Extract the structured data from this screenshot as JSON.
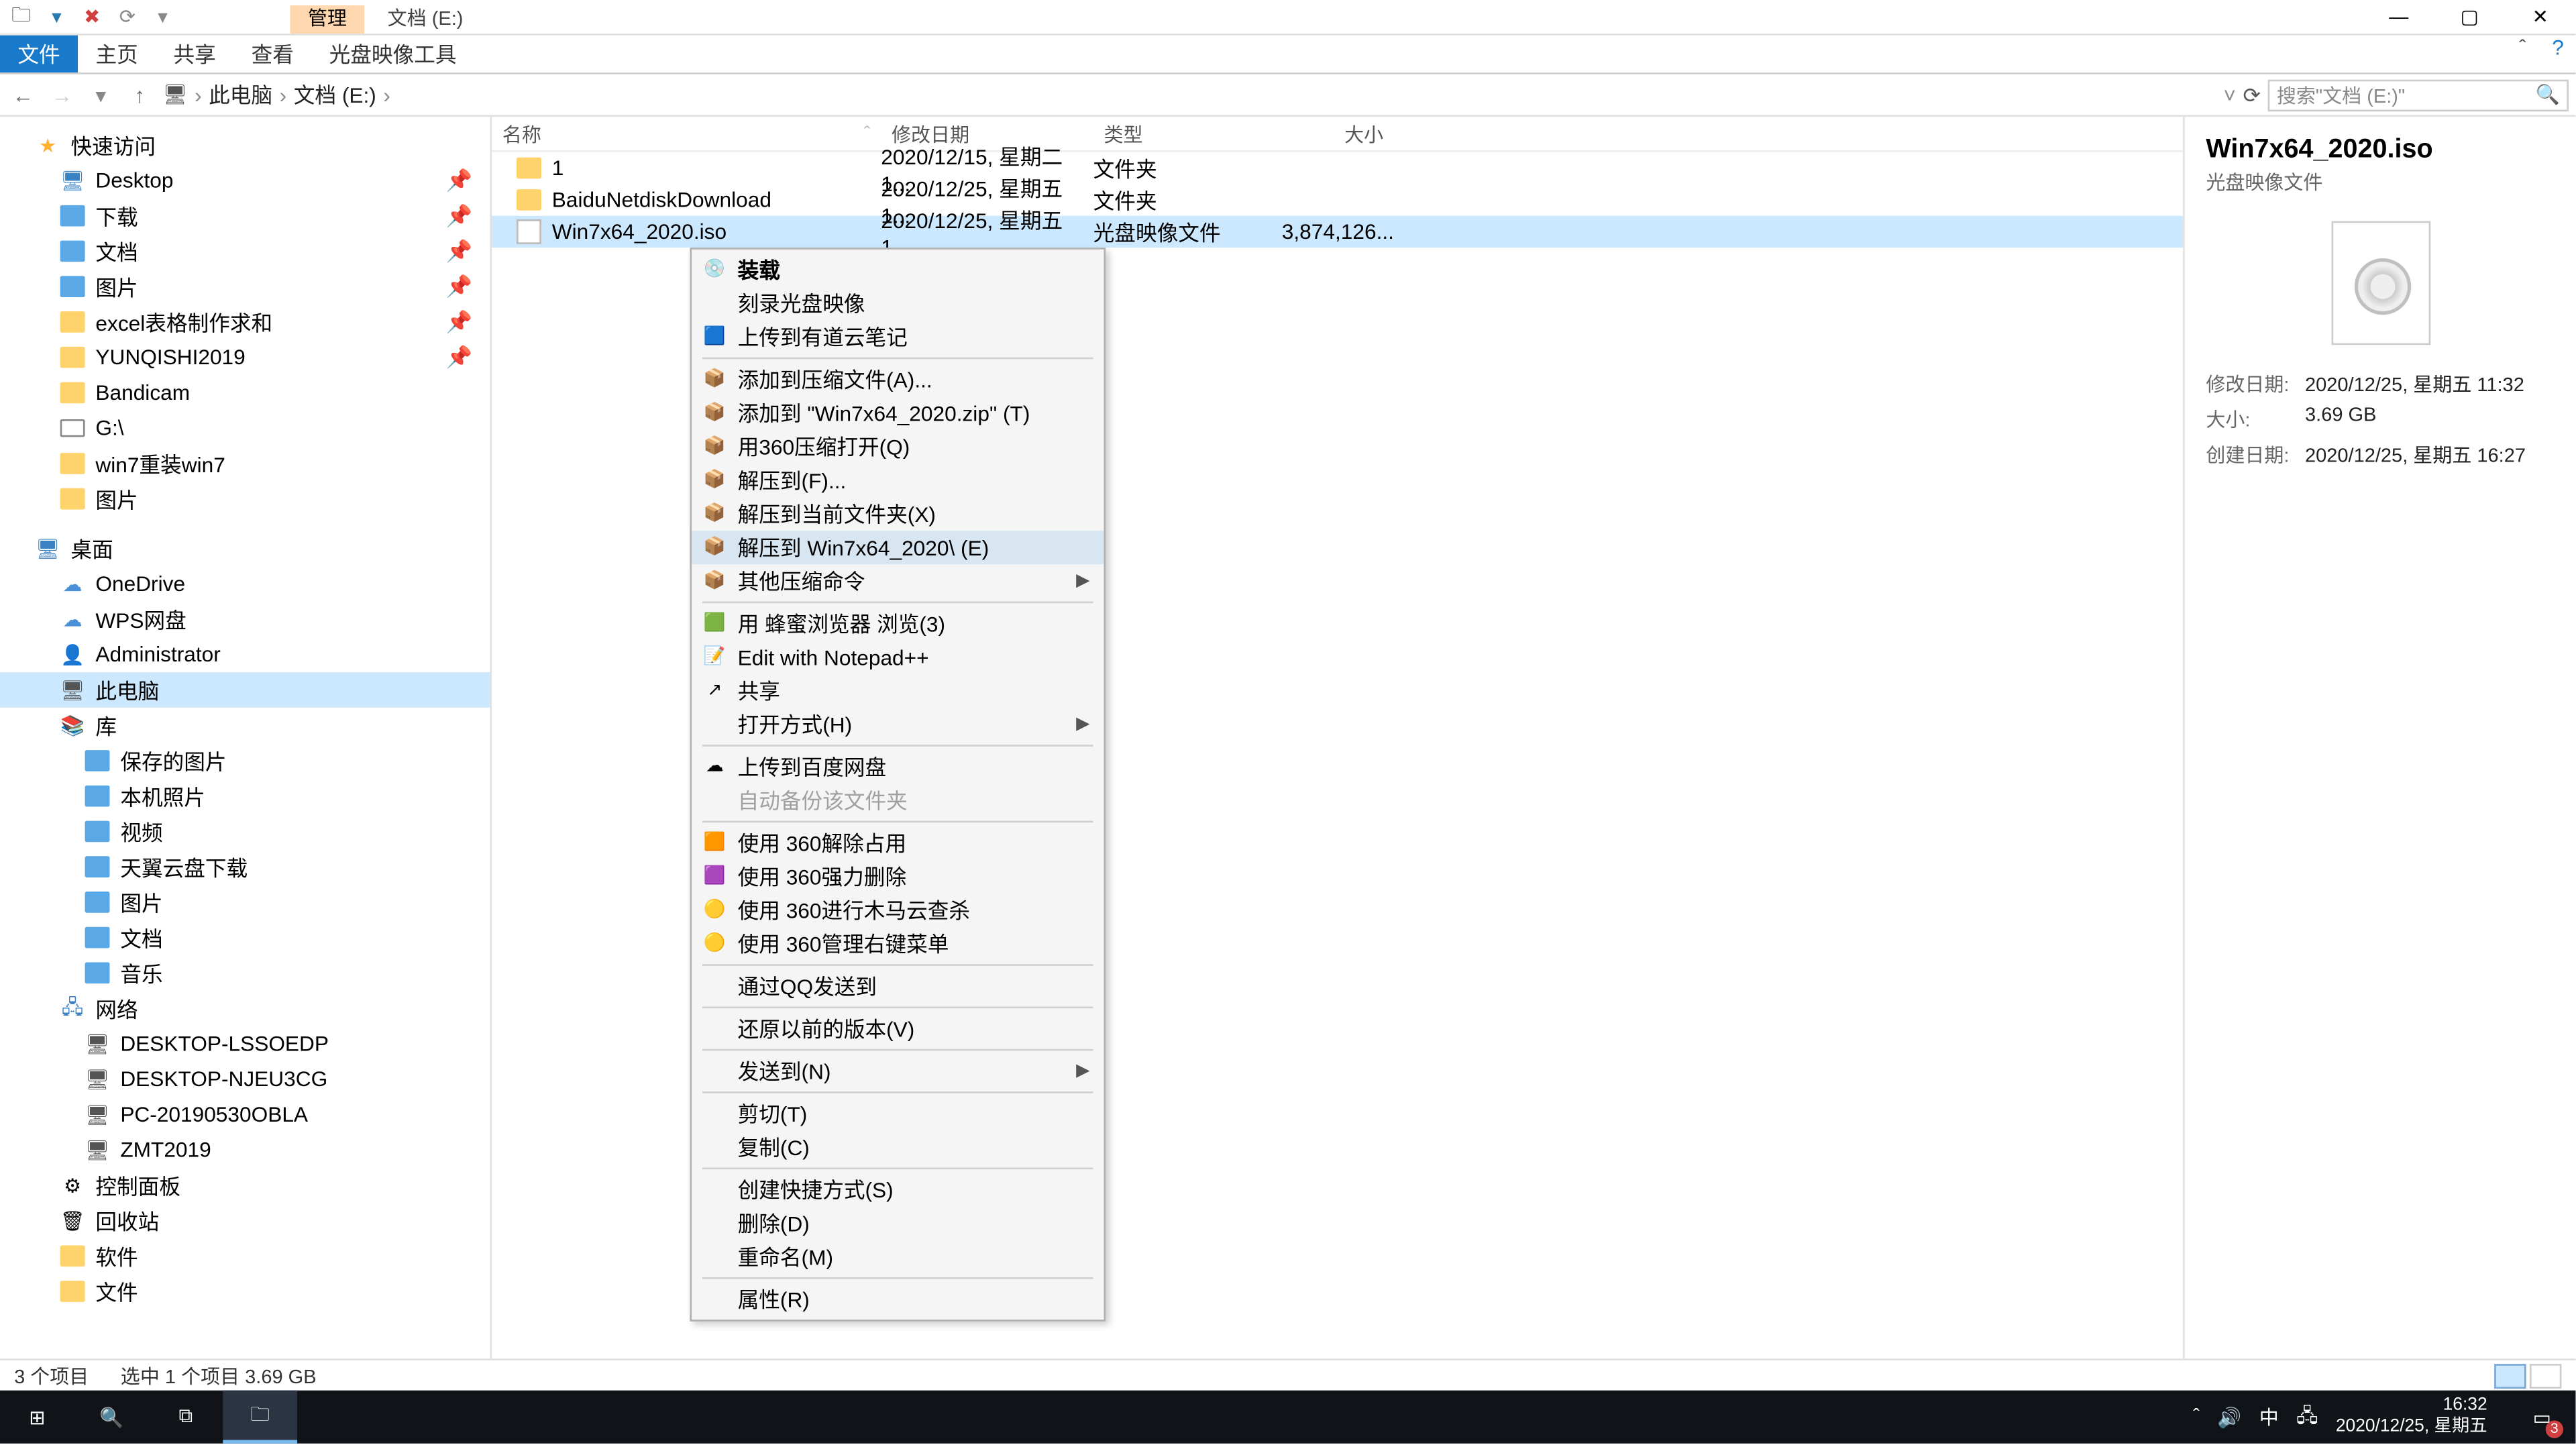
{
  "window": {
    "manageTab": "管理",
    "title": "文档 (E:)"
  },
  "ribbonTabs": {
    "file": "文件",
    "home": "主页",
    "share": "共享",
    "view": "查看",
    "disc": "光盘映像工具"
  },
  "breadcrumb": {
    "root": "此电脑",
    "folder": "文档 (E:)"
  },
  "search": {
    "placeholder": "搜索\"文档 (E:)\""
  },
  "sidebar": {
    "quick": "快速访问",
    "items1": [
      "Desktop",
      "下载",
      "文档",
      "图片",
      "excel表格制作求和",
      "YUNQISHI2019",
      "Bandicam",
      "G:\\",
      "win7重装win7",
      "图片"
    ],
    "desktop": "桌面",
    "items2": [
      "OneDrive",
      "WPS网盘",
      "Administrator",
      "此电脑",
      "库"
    ],
    "libs": [
      "保存的图片",
      "本机照片",
      "视频",
      "天翼云盘下载",
      "图片",
      "文档",
      "音乐"
    ],
    "network": "网络",
    "netItems": [
      "DESKTOP-LSSOEDP",
      "DESKTOP-NJEU3CG",
      "PC-20190530OBLA",
      "ZMT2019"
    ],
    "misc": [
      "控制面板",
      "回收站",
      "软件",
      "文件"
    ]
  },
  "columns": {
    "name": "名称",
    "date": "修改日期",
    "type": "类型",
    "size": "大小"
  },
  "rows": [
    {
      "name": "1",
      "date": "2020/12/15, 星期二 1...",
      "type": "文件夹",
      "size": ""
    },
    {
      "name": "BaiduNetdiskDownload",
      "date": "2020/12/25, 星期五 1...",
      "type": "文件夹",
      "size": ""
    },
    {
      "name": "Win7x64_2020.iso",
      "date": "2020/12/25, 星期五 1...",
      "type": "光盘映像文件",
      "size": "3,874,126..."
    }
  ],
  "context": {
    "g1": [
      {
        "t": "装载",
        "bold": true,
        "ico": "💿"
      },
      {
        "t": "刻录光盘映像"
      },
      {
        "t": "上传到有道云笔记",
        "ico": "🟦"
      }
    ],
    "g2": [
      {
        "t": "添加到压缩文件(A)...",
        "ico": "📦"
      },
      {
        "t": "添加到 \"Win7x64_2020.zip\" (T)",
        "ico": "📦"
      },
      {
        "t": "用360压缩打开(Q)",
        "ico": "📦"
      },
      {
        "t": "解压到(F)...",
        "ico": "📦"
      },
      {
        "t": "解压到当前文件夹(X)",
        "ico": "📦"
      },
      {
        "t": "解压到 Win7x64_2020\\ (E)",
        "ico": "📦",
        "hover": true
      },
      {
        "t": "其他压缩命令",
        "ico": "📦",
        "sub": true
      }
    ],
    "g3": [
      {
        "t": "用 蜂蜜浏览器 浏览(3)",
        "ico": "🟩"
      },
      {
        "t": "Edit with Notepad++",
        "ico": "📝"
      },
      {
        "t": "共享",
        "ico": "↗"
      },
      {
        "t": "打开方式(H)",
        "sub": true
      }
    ],
    "g4": [
      {
        "t": "上传到百度网盘",
        "ico": "☁"
      },
      {
        "t": "自动备份该文件夹",
        "disabled": true
      }
    ],
    "g5": [
      {
        "t": "使用 360解除占用",
        "ico": "🟧"
      },
      {
        "t": "使用 360强力删除",
        "ico": "🟪"
      },
      {
        "t": "使用 360进行木马云查杀",
        "ico": "🟡"
      },
      {
        "t": "使用 360管理右键菜单",
        "ico": "🟡"
      }
    ],
    "g6": [
      {
        "t": "通过QQ发送到"
      }
    ],
    "g7": [
      {
        "t": "还原以前的版本(V)"
      }
    ],
    "g8": [
      {
        "t": "发送到(N)",
        "sub": true
      }
    ],
    "g9": [
      {
        "t": "剪切(T)"
      },
      {
        "t": "复制(C)"
      }
    ],
    "g10": [
      {
        "t": "创建快捷方式(S)"
      },
      {
        "t": "删除(D)"
      },
      {
        "t": "重命名(M)"
      }
    ],
    "g11": [
      {
        "t": "属性(R)"
      }
    ]
  },
  "preview": {
    "name": "Win7x64_2020.iso",
    "type": "光盘映像文件",
    "kModified": "修改日期:",
    "vModified": "2020/12/25, 星期五 11:32",
    "kSize": "大小:",
    "vSize": "3.69 GB",
    "kCreated": "创建日期:",
    "vCreated": "2020/12/25, 星期五 16:27"
  },
  "status": {
    "count": "3 个项目",
    "sel": "选中 1 个项目  3.69 GB"
  },
  "tray": {
    "ime": "中",
    "time": "16:32",
    "date": "2020/12/25, 星期五",
    "badge": "3"
  }
}
